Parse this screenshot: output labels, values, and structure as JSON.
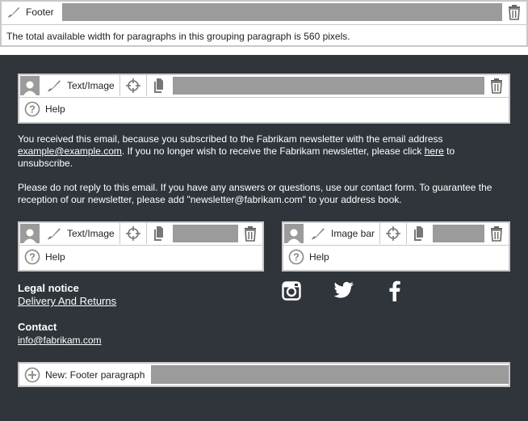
{
  "footer_block": {
    "label": "Footer",
    "info": "The total available width for paragraphs in this grouping paragraph is 560 pixels."
  },
  "text_image_block": {
    "label": "Text/Image",
    "help": "Help"
  },
  "email_text": {
    "p1_a": "You received this email, because you subscribed to the Fabrikam newsletter with the email address",
    "p1_email": "example@example.com",
    "p1_b": ". If you no longer wish to receive the Fabrikam newsletter, please click ",
    "p1_here": "here",
    "p1_c": " to",
    "p1_d": "unsubscribe.",
    "p2_a": "Please do not reply to this email. If you have any answers or questions, use our contact form. To guarantee the",
    "p2_b": "reception of our newsletter, please add \"newsletter@fabrikam.com\" to your address book."
  },
  "left_block": {
    "label": "Text/Image",
    "help": "Help"
  },
  "right_block": {
    "label": "Image bar",
    "help": "Help"
  },
  "legal": {
    "heading": "Legal notice",
    "link": "Delivery And Returns"
  },
  "contact": {
    "heading": "Contact",
    "email": "info@fabrikam.com"
  },
  "social": {
    "icons": [
      "instagram-icon",
      "twitter-icon",
      "facebook-icon"
    ]
  },
  "new_paragraph": {
    "label": "New: Footer paragraph"
  },
  "colors": {
    "dark_bg": "#30343b",
    "bar_gray": "#9b9b9b",
    "border": "#c8c8c8"
  }
}
